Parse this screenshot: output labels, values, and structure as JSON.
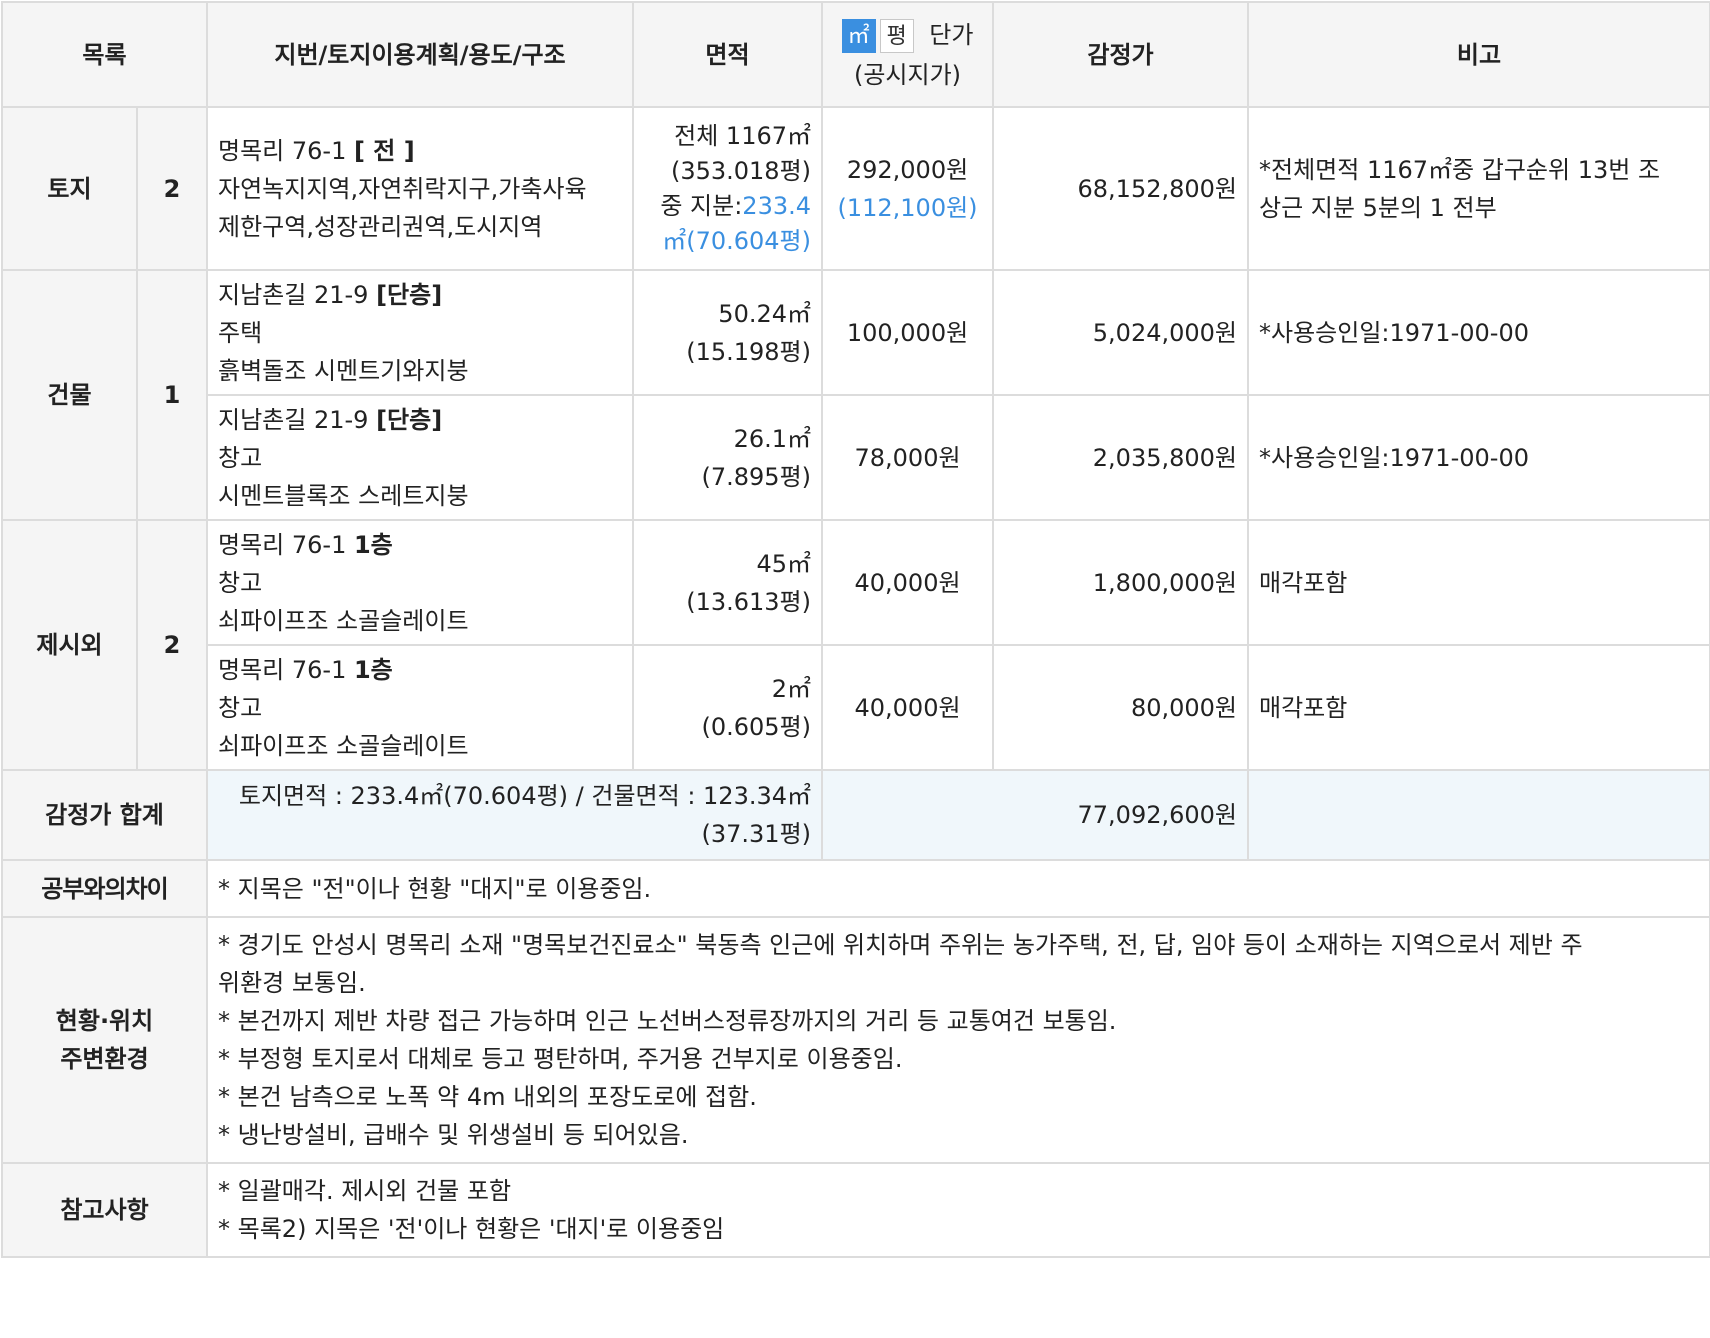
{
  "headers": {
    "list": "목록",
    "lot": "지번/토지이용계획/용도/구조",
    "area": "면적",
    "unit_sqm": "㎡",
    "unit_pyeong": "평",
    "price_title": "단가",
    "price_sub": "(공시지가)",
    "appraisal": "감정가",
    "remarks": "비고"
  },
  "land": {
    "category": "토지",
    "count": "2",
    "row": {
      "lot_prefix": "명목리 76-1 ",
      "lot_tag": "[ 전 ]",
      "lines": [
        "자연녹지지역,자연취락지구,가축사육",
        "제한구역,성장관리권역,도시지역"
      ],
      "area_line1": "전체 1167㎡",
      "area_line2": "(353.018평)",
      "area_line3_prefix": "중 지분:",
      "area_line3_value": "233.4",
      "area_line4": "㎡(70.604평)",
      "unit_price": "292,000원",
      "official_price": "(112,100원)",
      "appraisal": "68,152,800원",
      "remark_lines": [
        "*전체면적 1167㎡중 갑구순위 13번 조",
        "상근 지분 5분의 1 전부"
      ]
    }
  },
  "building": {
    "category": "건물",
    "count": "1",
    "rows": [
      {
        "lot_prefix": "지남촌길 21-9 ",
        "lot_tag": "[단층]",
        "use": "주택",
        "structure": "흙벽돌조 시멘트기와지붕",
        "area": "50.24㎡",
        "pyeong": "(15.198평)",
        "unit_price": "100,000원",
        "appraisal": "5,024,000원",
        "remark": "*사용승인일:1971-00-00"
      },
      {
        "lot_prefix": "지남촌길 21-9 ",
        "lot_tag": "[단층]",
        "use": "창고",
        "structure": "시멘트블록조 스레트지붕",
        "area": "26.1㎡",
        "pyeong": "(7.895평)",
        "unit_price": "78,000원",
        "appraisal": "2,035,800원",
        "remark": "*사용승인일:1971-00-00"
      }
    ]
  },
  "extra": {
    "category": "제시외",
    "count": "2",
    "rows": [
      {
        "lot_prefix": "명목리 76-1 ",
        "lot_tag": "1층",
        "use": "창고",
        "structure": "쇠파이프조 소골슬레이트",
        "area": "45㎡",
        "pyeong": "(13.613평)",
        "unit_price": "40,000원",
        "appraisal": "1,800,000원",
        "remark": "매각포함"
      },
      {
        "lot_prefix": "명목리 76-1 ",
        "lot_tag": "1층",
        "use": "창고",
        "structure": "쇠파이프조 소골슬레이트",
        "area": "2㎡",
        "pyeong": "(0.605평)",
        "unit_price": "40,000원",
        "appraisal": "80,000원",
        "remark": "매각포함"
      }
    ]
  },
  "total": {
    "label": "감정가 합계",
    "area_line1": "토지면적 : 233.4㎡(70.604평) / 건물면적 : 123.34㎡",
    "area_line2": "(37.31평)",
    "amount": "77,092,600원"
  },
  "difference": {
    "label": "공부와의차이",
    "text": "* 지목은 \"전\"이나 현황 \"대지\"로 이용중임."
  },
  "location": {
    "label_line1": "현황·위치",
    "label_line2": "주변환경",
    "lines": [
      "* 경기도 안성시 명목리 소재 \"명목보건진료소\" 북동측 인근에 위치하며 주위는 농가주택, 전, 답, 임야 등이 소재하는 지역으로서 제반 주",
      "위환경 보통임.",
      "* 본건까지 제반 차량 접근 가능하며 인근 노선버스정류장까지의 거리 등 교통여건 보통임.",
      "* 부정형 토지로서 대체로 등고 평탄하며, 주거용 건부지로 이용중임.",
      "* 본건 남측으로 노폭 약 4m 내외의 포장도로에 접함.",
      "* 냉난방설비, 급배수 및 위생설비 등 되어있음."
    ]
  },
  "reference": {
    "label": "참고사항",
    "lines": [
      "* 일괄매각. 제시외 건물 포함",
      "* 목록2) 지목은 '전'이나 현황은 '대지'로 이용중임"
    ]
  },
  "colors": {
    "header_bg": "#f5f5f5",
    "total_bg": "#f0f7fb",
    "accent_blue": "#3a8fe0",
    "border": "#dcdcdc"
  }
}
